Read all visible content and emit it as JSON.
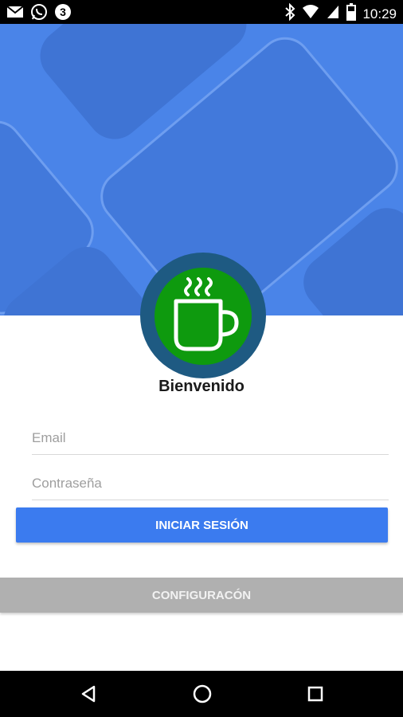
{
  "status_bar": {
    "time": "10:29",
    "left_icons": [
      "gmail-icon",
      "whatsapp-icon",
      "notification-badge-icon"
    ],
    "right_icons": [
      "bluetooth-icon",
      "wifi-icon",
      "signal-icon",
      "battery-icon"
    ]
  },
  "login": {
    "welcome_title": "Bienvenido",
    "email_placeholder": "Email",
    "password_placeholder": "Contraseña",
    "login_button": "INICIAR SESIÓN",
    "config_button": "CONFIGURACÓN"
  },
  "logo": {
    "icon": "coffee-cup-icon",
    "ring_color": "#1e5a82",
    "fill_color": "#0e9a0e"
  },
  "colors": {
    "hero": "#4a84e8",
    "primary": "#3b7bef",
    "secondary": "#b0b0b0"
  },
  "nav_bar": {
    "icons": [
      "back-icon",
      "home-icon",
      "recents-icon"
    ]
  }
}
